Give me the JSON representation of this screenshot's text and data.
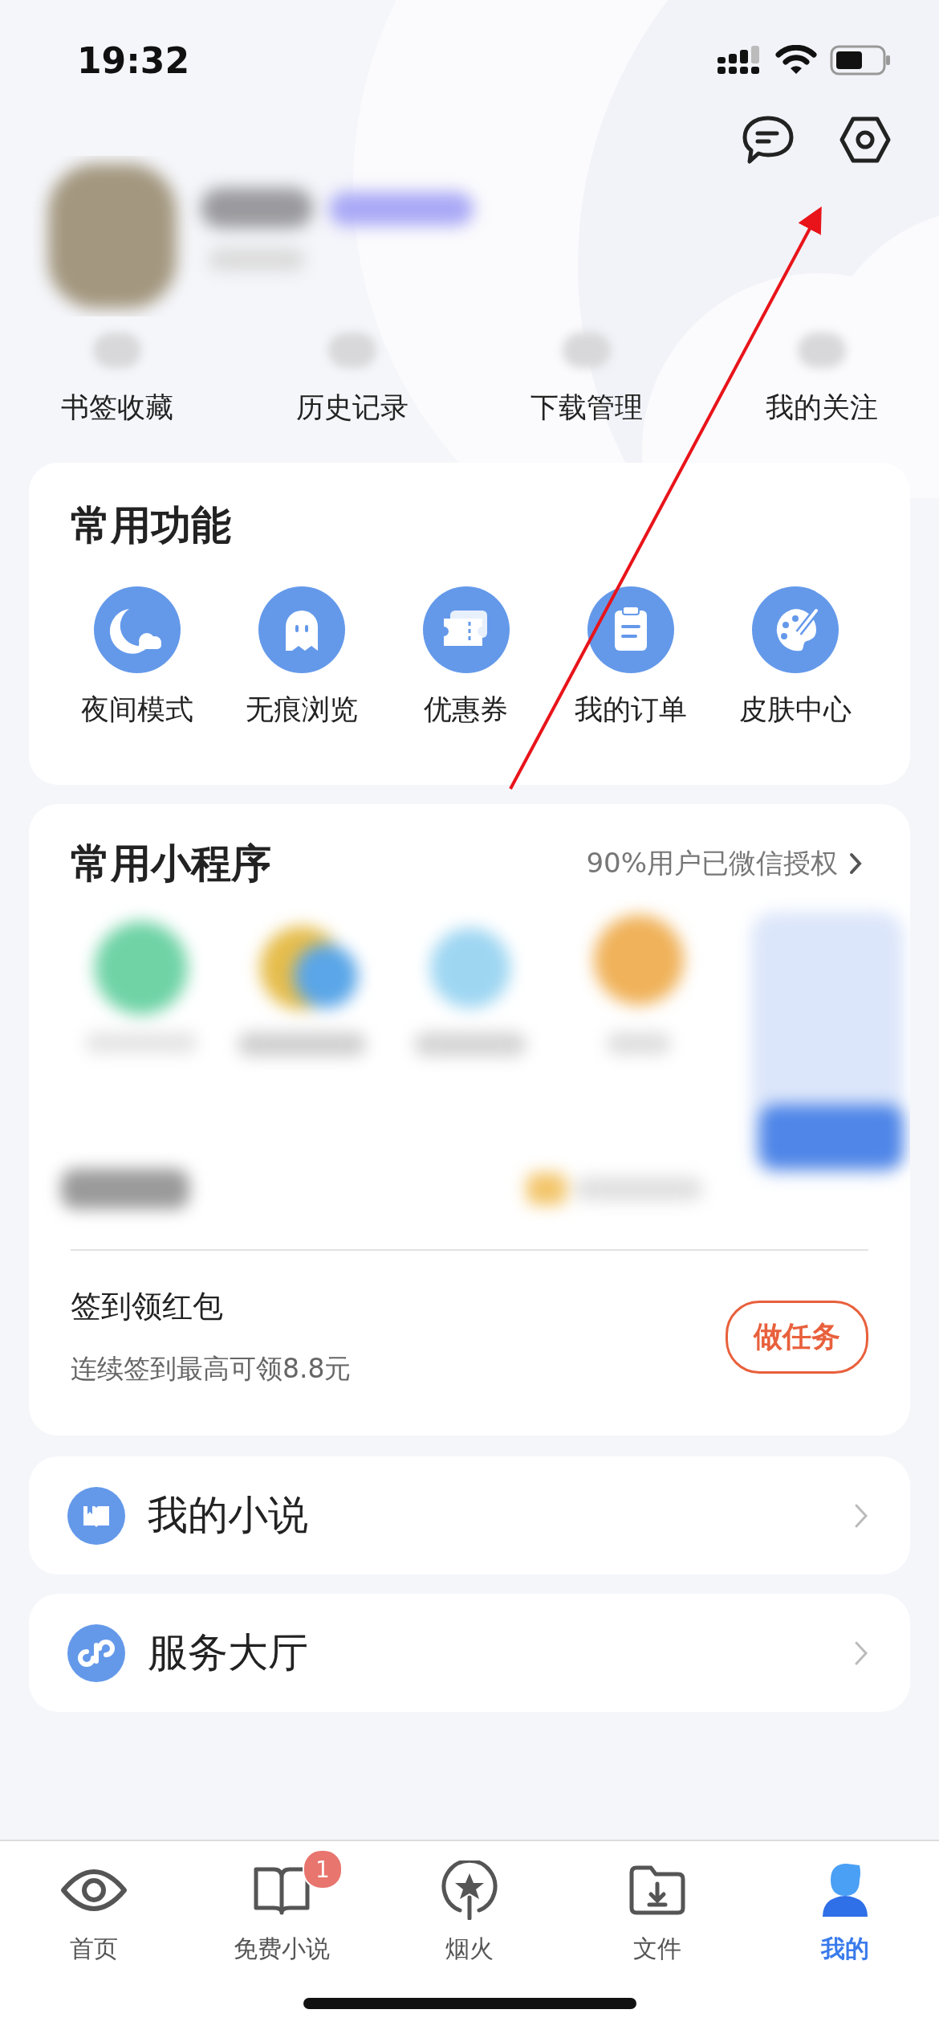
{
  "status_bar": {
    "time": "19:32"
  },
  "quick_links": [
    {
      "label": "书签收藏"
    },
    {
      "label": "历史记录"
    },
    {
      "label": "下载管理"
    },
    {
      "label": "我的关注"
    }
  ],
  "common_functions": {
    "title": "常用功能",
    "items": [
      {
        "label": "夜间模式"
      },
      {
        "label": "无痕浏览"
      },
      {
        "label": "优惠券"
      },
      {
        "label": "我的订单"
      },
      {
        "label": "皮肤中心"
      }
    ]
  },
  "mini_programs": {
    "title": "常用小程序",
    "link": "90%用户已微信授权"
  },
  "checkin": {
    "title": "签到领红包",
    "subtitle": "连续签到最高可领8.8元",
    "button": "做任务"
  },
  "menu_rows": [
    {
      "label": "我的小说"
    },
    {
      "label": "服务大厅"
    }
  ],
  "tab_bar": [
    {
      "label": "首页",
      "selected": false
    },
    {
      "label": "免费小说",
      "selected": false,
      "badge": "1"
    },
    {
      "label": "烟火",
      "selected": false
    },
    {
      "label": "文件",
      "selected": false
    },
    {
      "label": "我的",
      "selected": true
    }
  ]
}
